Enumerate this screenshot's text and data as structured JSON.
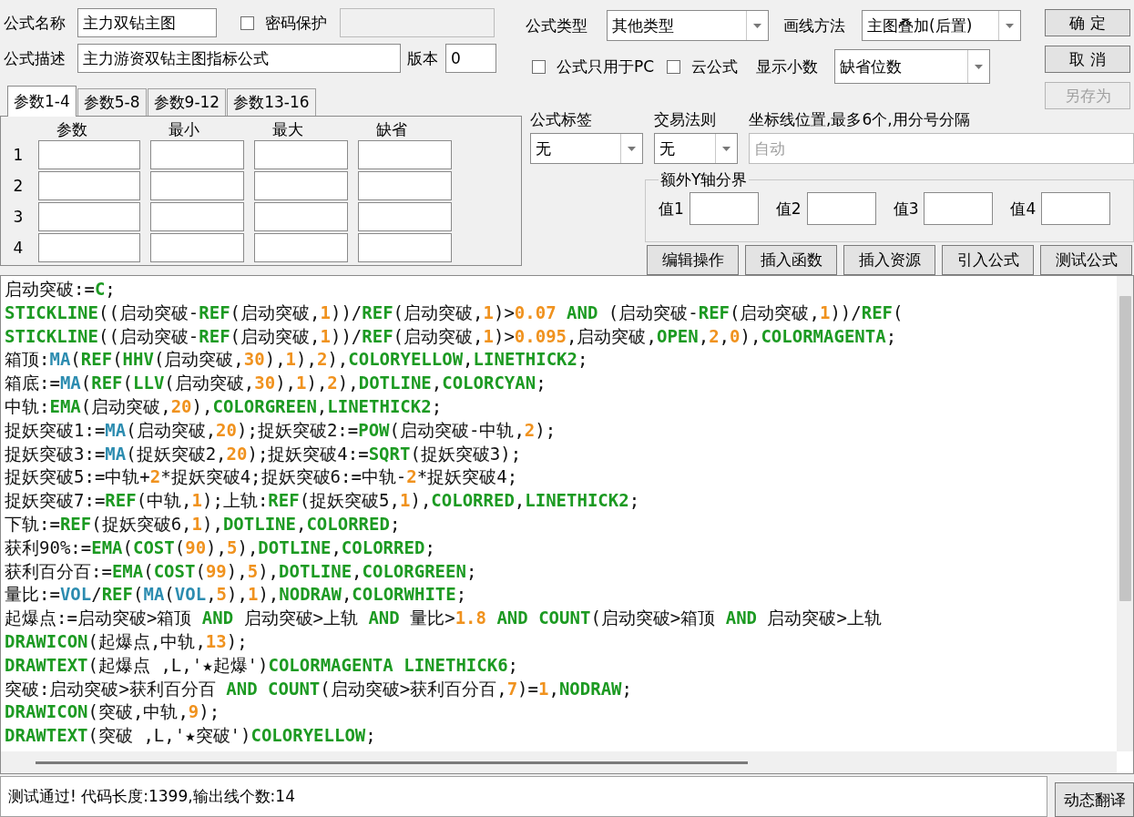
{
  "formula_name": {
    "label": "公式名称",
    "value": "主力双钻主图"
  },
  "password_protect": {
    "label": "密码保护",
    "checked": false,
    "field_disabled": true
  },
  "description": {
    "label": "公式描述",
    "value": "主力游资双钻主图指标公式"
  },
  "version": {
    "label": "版本",
    "value": "0"
  },
  "param_tabs": [
    {
      "label": "参数1-4",
      "selected": true
    },
    {
      "label": "参数5-8",
      "selected": false
    },
    {
      "label": "参数9-12",
      "selected": false
    },
    {
      "label": "参数13-16",
      "selected": false
    }
  ],
  "param_table": {
    "columns": [
      "参数",
      "最小",
      "最大",
      "缺省"
    ],
    "rows": [
      "1",
      "2",
      "3",
      "4"
    ]
  },
  "formula_type": {
    "label": "公式类型",
    "value": "其他类型"
  },
  "draw_method": {
    "label": "画线方法",
    "value": "主图叠加(后置)"
  },
  "pc_only": {
    "label": "公式只用于PC",
    "checked": false
  },
  "cloud_formula": {
    "label": "云公式",
    "checked": false
  },
  "decimals": {
    "label": "显示小数",
    "value": "缺省位数"
  },
  "dialog_buttons": [
    {
      "label": "确 定",
      "disabled": false
    },
    {
      "label": "取 消",
      "disabled": false
    },
    {
      "label": "另存为",
      "disabled": true
    }
  ],
  "formula_tag": {
    "label": "公式标签",
    "value": "无"
  },
  "trade_rule": {
    "label": "交易法则",
    "value": "无"
  },
  "axis_lines": {
    "label": "坐标线位置,最多6个,用分号分隔",
    "placeholder": "自动"
  },
  "y_bounds": {
    "title": "额外Y轴分界",
    "fields": [
      "值1",
      "值2",
      "值3",
      "值4"
    ]
  },
  "action_buttons": [
    "编辑操作",
    "插入函数",
    "插入资源",
    "引入公式",
    "测试公式"
  ],
  "code_lines": [
    [
      {
        "text": "启动突破:=",
        "kind": "text"
      },
      {
        "text": "C",
        "kind": "keyword"
      },
      {
        "text": ";",
        "kind": "text"
      }
    ],
    [
      {
        "text": "STICKLINE",
        "kind": "keyword"
      },
      {
        "text": "((启动突破-",
        "kind": "text"
      },
      {
        "text": "REF",
        "kind": "keyword"
      },
      {
        "text": "(启动突破,",
        "kind": "text"
      },
      {
        "text": "1",
        "kind": "number"
      },
      {
        "text": "))/",
        "kind": "text"
      },
      {
        "text": "REF",
        "kind": "keyword"
      },
      {
        "text": "(启动突破,",
        "kind": "text"
      },
      {
        "text": "1",
        "kind": "number"
      },
      {
        "text": ")>",
        "kind": "text"
      },
      {
        "text": "0.07",
        "kind": "number"
      },
      {
        "text": " AND",
        "kind": "keyword"
      },
      {
        "text": " (启动突破-",
        "kind": "text"
      },
      {
        "text": "REF",
        "kind": "keyword"
      },
      {
        "text": "(启动突破,",
        "kind": "text"
      },
      {
        "text": "1",
        "kind": "number"
      },
      {
        "text": "))/",
        "kind": "text"
      },
      {
        "text": "REF",
        "kind": "keyword"
      },
      {
        "text": "(",
        "kind": "text"
      }
    ],
    [
      {
        "text": "STICKLINE",
        "kind": "keyword"
      },
      {
        "text": "((启动突破-",
        "kind": "text"
      },
      {
        "text": "REF",
        "kind": "keyword"
      },
      {
        "text": "(启动突破,",
        "kind": "text"
      },
      {
        "text": "1",
        "kind": "number"
      },
      {
        "text": "))/",
        "kind": "text"
      },
      {
        "text": "REF",
        "kind": "keyword"
      },
      {
        "text": "(启动突破,",
        "kind": "text"
      },
      {
        "text": "1",
        "kind": "number"
      },
      {
        "text": ")>",
        "kind": "text"
      },
      {
        "text": "0.095",
        "kind": "number"
      },
      {
        "text": ",启动突破,",
        "kind": "text"
      },
      {
        "text": "OPEN",
        "kind": "keyword"
      },
      {
        "text": ",",
        "kind": "text"
      },
      {
        "text": "2",
        "kind": "number"
      },
      {
        "text": ",",
        "kind": "text"
      },
      {
        "text": "0",
        "kind": "number"
      },
      {
        "text": "),",
        "kind": "text"
      },
      {
        "text": "COLORMAGENTA",
        "kind": "keyword"
      },
      {
        "text": ";",
        "kind": "text"
      }
    ],
    [
      {
        "text": "箱顶:",
        "kind": "text"
      },
      {
        "text": "MA",
        "kind": "function"
      },
      {
        "text": "(",
        "kind": "text"
      },
      {
        "text": "REF",
        "kind": "keyword"
      },
      {
        "text": "(",
        "kind": "text"
      },
      {
        "text": "HHV",
        "kind": "keyword"
      },
      {
        "text": "(启动突破,",
        "kind": "text"
      },
      {
        "text": "30",
        "kind": "number"
      },
      {
        "text": "),",
        "kind": "text"
      },
      {
        "text": "1",
        "kind": "number"
      },
      {
        "text": "),",
        "kind": "text"
      },
      {
        "text": "2",
        "kind": "number"
      },
      {
        "text": "),",
        "kind": "text"
      },
      {
        "text": "COLORYELLOW",
        "kind": "keyword"
      },
      {
        "text": ",",
        "kind": "text"
      },
      {
        "text": "LINETHICK2",
        "kind": "keyword"
      },
      {
        "text": ";",
        "kind": "text"
      }
    ],
    [
      {
        "text": "箱底:=",
        "kind": "text"
      },
      {
        "text": "MA",
        "kind": "function"
      },
      {
        "text": "(",
        "kind": "text"
      },
      {
        "text": "REF",
        "kind": "keyword"
      },
      {
        "text": "(",
        "kind": "text"
      },
      {
        "text": "LLV",
        "kind": "keyword"
      },
      {
        "text": "(启动突破,",
        "kind": "text"
      },
      {
        "text": "30",
        "kind": "number"
      },
      {
        "text": "),",
        "kind": "text"
      },
      {
        "text": "1",
        "kind": "number"
      },
      {
        "text": "),",
        "kind": "text"
      },
      {
        "text": "2",
        "kind": "number"
      },
      {
        "text": "),",
        "kind": "text"
      },
      {
        "text": "DOTLINE",
        "kind": "keyword"
      },
      {
        "text": ",",
        "kind": "text"
      },
      {
        "text": "COLORCYAN",
        "kind": "keyword"
      },
      {
        "text": ";",
        "kind": "text"
      }
    ],
    [
      {
        "text": "中轨:",
        "kind": "text"
      },
      {
        "text": "EMA",
        "kind": "keyword"
      },
      {
        "text": "(启动突破,",
        "kind": "text"
      },
      {
        "text": "20",
        "kind": "number"
      },
      {
        "text": "),",
        "kind": "text"
      },
      {
        "text": "COLORGREEN",
        "kind": "keyword"
      },
      {
        "text": ",",
        "kind": "text"
      },
      {
        "text": "LINETHICK2",
        "kind": "keyword"
      },
      {
        "text": ";",
        "kind": "text"
      }
    ],
    [
      {
        "text": "捉妖突破1:=",
        "kind": "text"
      },
      {
        "text": "MA",
        "kind": "function"
      },
      {
        "text": "(启动突破,",
        "kind": "text"
      },
      {
        "text": "20",
        "kind": "number"
      },
      {
        "text": ");捉妖突破2:=",
        "kind": "text"
      },
      {
        "text": "POW",
        "kind": "keyword"
      },
      {
        "text": "(启动突破-中轨,",
        "kind": "text"
      },
      {
        "text": "2",
        "kind": "number"
      },
      {
        "text": ");",
        "kind": "text"
      }
    ],
    [
      {
        "text": "捉妖突破3:=",
        "kind": "text"
      },
      {
        "text": "MA",
        "kind": "function"
      },
      {
        "text": "(捉妖突破2,",
        "kind": "text"
      },
      {
        "text": "20",
        "kind": "number"
      },
      {
        "text": ");捉妖突破4:=",
        "kind": "text"
      },
      {
        "text": "SQRT",
        "kind": "keyword"
      },
      {
        "text": "(捉妖突破3);",
        "kind": "text"
      }
    ],
    [
      {
        "text": "捉妖突破5:=中轨+",
        "kind": "text"
      },
      {
        "text": "2",
        "kind": "number"
      },
      {
        "text": "*捉妖突破4;捉妖突破6:=中轨-",
        "kind": "text"
      },
      {
        "text": "2",
        "kind": "number"
      },
      {
        "text": "*捉妖突破4;",
        "kind": "text"
      }
    ],
    [
      {
        "text": "捉妖突破7:=",
        "kind": "text"
      },
      {
        "text": "REF",
        "kind": "keyword"
      },
      {
        "text": "(中轨,",
        "kind": "text"
      },
      {
        "text": "1",
        "kind": "number"
      },
      {
        "text": ");上轨:",
        "kind": "text"
      },
      {
        "text": "REF",
        "kind": "keyword"
      },
      {
        "text": "(捉妖突破5,",
        "kind": "text"
      },
      {
        "text": "1",
        "kind": "number"
      },
      {
        "text": "),",
        "kind": "text"
      },
      {
        "text": "COLORRED",
        "kind": "keyword"
      },
      {
        "text": ",",
        "kind": "text"
      },
      {
        "text": "LINETHICK2",
        "kind": "keyword"
      },
      {
        "text": ";",
        "kind": "text"
      }
    ],
    [
      {
        "text": "下轨:=",
        "kind": "text"
      },
      {
        "text": "REF",
        "kind": "keyword"
      },
      {
        "text": "(捉妖突破6,",
        "kind": "text"
      },
      {
        "text": "1",
        "kind": "number"
      },
      {
        "text": "),",
        "kind": "text"
      },
      {
        "text": "DOTLINE",
        "kind": "keyword"
      },
      {
        "text": ",",
        "kind": "text"
      },
      {
        "text": "COLORRED",
        "kind": "keyword"
      },
      {
        "text": ";",
        "kind": "text"
      }
    ],
    [
      {
        "text": "获利90%:=",
        "kind": "text"
      },
      {
        "text": "EMA",
        "kind": "keyword"
      },
      {
        "text": "(",
        "kind": "text"
      },
      {
        "text": "COST",
        "kind": "keyword"
      },
      {
        "text": "(",
        "kind": "text"
      },
      {
        "text": "90",
        "kind": "number"
      },
      {
        "text": "),",
        "kind": "text"
      },
      {
        "text": "5",
        "kind": "number"
      },
      {
        "text": "),",
        "kind": "text"
      },
      {
        "text": "DOTLINE",
        "kind": "keyword"
      },
      {
        "text": ",",
        "kind": "text"
      },
      {
        "text": "COLORRED",
        "kind": "keyword"
      },
      {
        "text": ";",
        "kind": "text"
      }
    ],
    [
      {
        "text": "获利百分百:=",
        "kind": "text"
      },
      {
        "text": "EMA",
        "kind": "keyword"
      },
      {
        "text": "(",
        "kind": "text"
      },
      {
        "text": "COST",
        "kind": "keyword"
      },
      {
        "text": "(",
        "kind": "text"
      },
      {
        "text": "99",
        "kind": "number"
      },
      {
        "text": "),",
        "kind": "text"
      },
      {
        "text": "5",
        "kind": "number"
      },
      {
        "text": "),",
        "kind": "text"
      },
      {
        "text": "DOTLINE",
        "kind": "keyword"
      },
      {
        "text": ",",
        "kind": "text"
      },
      {
        "text": "COLORGREEN",
        "kind": "keyword"
      },
      {
        "text": ";",
        "kind": "text"
      }
    ],
    [
      {
        "text": "量比:=",
        "kind": "text"
      },
      {
        "text": "VOL",
        "kind": "function"
      },
      {
        "text": "/",
        "kind": "text"
      },
      {
        "text": "REF",
        "kind": "keyword"
      },
      {
        "text": "(",
        "kind": "text"
      },
      {
        "text": "MA",
        "kind": "function"
      },
      {
        "text": "(",
        "kind": "text"
      },
      {
        "text": "VOL",
        "kind": "function"
      },
      {
        "text": ",",
        "kind": "text"
      },
      {
        "text": "5",
        "kind": "number"
      },
      {
        "text": "),",
        "kind": "text"
      },
      {
        "text": "1",
        "kind": "number"
      },
      {
        "text": "),",
        "kind": "text"
      },
      {
        "text": "NODRAW",
        "kind": "keyword"
      },
      {
        "text": ",",
        "kind": "text"
      },
      {
        "text": "COLORWHITE",
        "kind": "keyword"
      },
      {
        "text": ";",
        "kind": "text"
      }
    ],
    [
      {
        "text": "起爆点:=启动突破>箱顶 ",
        "kind": "text"
      },
      {
        "text": "AND",
        "kind": "keyword"
      },
      {
        "text": " 启动突破>上轨 ",
        "kind": "text"
      },
      {
        "text": "AND",
        "kind": "keyword"
      },
      {
        "text": " 量比>",
        "kind": "text"
      },
      {
        "text": "1.8",
        "kind": "number"
      },
      {
        "text": " AND",
        "kind": "keyword"
      },
      {
        "text": " COUNT",
        "kind": "keyword"
      },
      {
        "text": "(启动突破>箱顶 ",
        "kind": "text"
      },
      {
        "text": "AND",
        "kind": "keyword"
      },
      {
        "text": " 启动突破>上轨",
        "kind": "text"
      }
    ],
    [
      {
        "text": "DRAWICON",
        "kind": "keyword"
      },
      {
        "text": "(起爆点,中轨,",
        "kind": "text"
      },
      {
        "text": "13",
        "kind": "number"
      },
      {
        "text": ");",
        "kind": "text"
      }
    ],
    [
      {
        "text": "DRAWTEXT",
        "kind": "keyword"
      },
      {
        "text": "(起爆点 ,L,'★起爆')",
        "kind": "text"
      },
      {
        "text": "COLORMAGENTA",
        "kind": "keyword"
      },
      {
        "text": " LINETHICK6",
        "kind": "keyword"
      },
      {
        "text": ";",
        "kind": "text"
      }
    ],
    [
      {
        "text": "突破:启动突破>获利百分百 ",
        "kind": "text"
      },
      {
        "text": "AND",
        "kind": "keyword"
      },
      {
        "text": " COUNT",
        "kind": "keyword"
      },
      {
        "text": "(启动突破>获利百分百,",
        "kind": "text"
      },
      {
        "text": "7",
        "kind": "number"
      },
      {
        "text": ")=",
        "kind": "text"
      },
      {
        "text": "1",
        "kind": "number"
      },
      {
        "text": ",",
        "kind": "text"
      },
      {
        "text": "NODRAW",
        "kind": "keyword"
      },
      {
        "text": ";",
        "kind": "text"
      }
    ],
    [
      {
        "text": "DRAWICON",
        "kind": "keyword"
      },
      {
        "text": "(突破,中轨,",
        "kind": "text"
      },
      {
        "text": "9",
        "kind": "number"
      },
      {
        "text": ");",
        "kind": "text"
      }
    ],
    [
      {
        "text": "DRAWTEXT",
        "kind": "keyword"
      },
      {
        "text": "(突破 ,L,'★突破')",
        "kind": "text"
      },
      {
        "text": "COLORYELLOW",
        "kind": "keyword"
      },
      {
        "text": ";",
        "kind": "text"
      }
    ]
  ],
  "status": {
    "message": "测试通过! 代码长度:1399,输出线个数:14",
    "button": "动态翻译"
  }
}
